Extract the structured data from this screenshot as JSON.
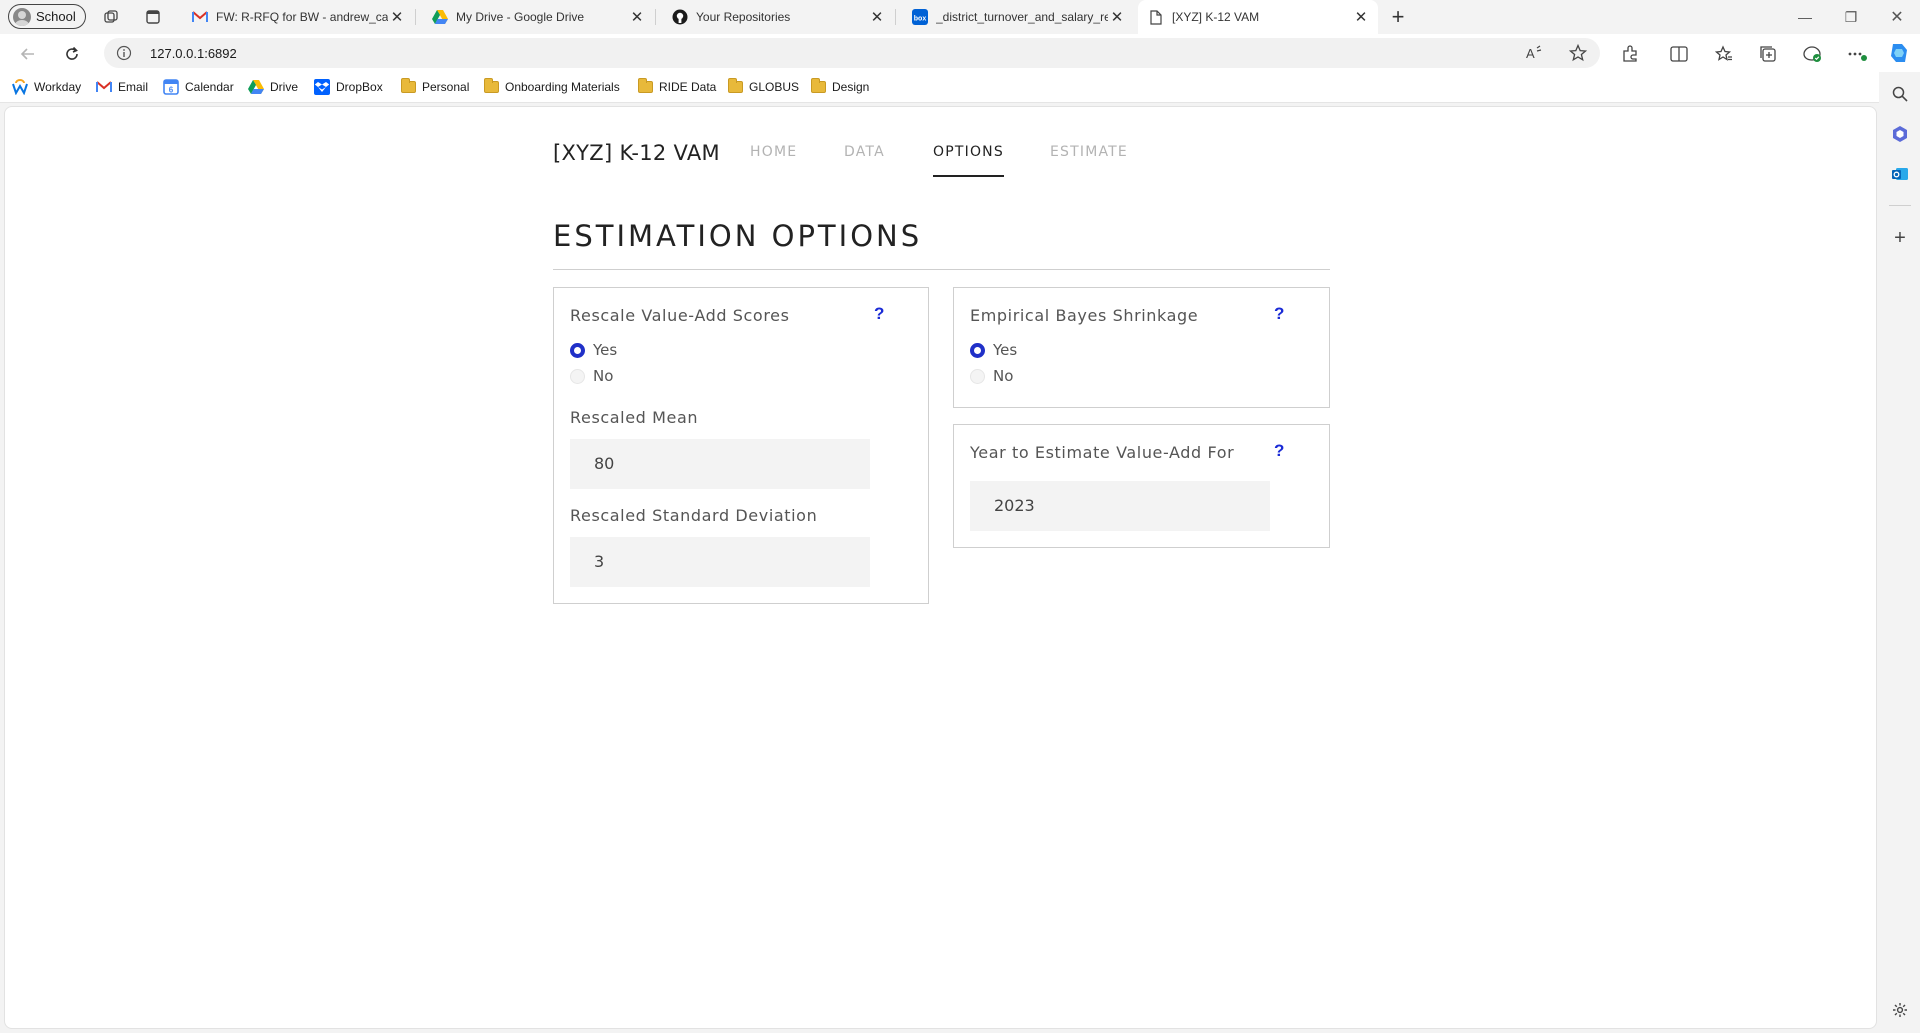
{
  "browser": {
    "profile_label": "School",
    "tabs": [
      {
        "title": "FW: R-RFQ for BW - andrew_cam"
      },
      {
        "title": "My Drive - Google Drive"
      },
      {
        "title": "Your Repositories"
      },
      {
        "title": "_district_turnover_and_salary_rep"
      },
      {
        "title": "[XYZ] K-12 VAM"
      }
    ],
    "url": "127.0.0.1:6892",
    "bookmarks": [
      {
        "label": "Workday"
      },
      {
        "label": "Email"
      },
      {
        "label": "Calendar"
      },
      {
        "label": "Drive"
      },
      {
        "label": "DropBox"
      },
      {
        "label": "Personal"
      },
      {
        "label": "Onboarding Materials"
      },
      {
        "label": "RIDE Data"
      },
      {
        "label": "GLOBUS"
      },
      {
        "label": "Design"
      }
    ],
    "colors": {
      "accent": "#2030c8",
      "help": "#1a2bd6"
    }
  },
  "app": {
    "brand": "[XYZ] K-12 VAM",
    "nav": [
      {
        "label": "HOME"
      },
      {
        "label": "DATA"
      },
      {
        "label": "OPTIONS",
        "active": true
      },
      {
        "label": "ESTIMATE"
      }
    ],
    "page_title": "ESTIMATION OPTIONS",
    "rescale": {
      "label": "Rescale Value-Add Scores",
      "help": "?",
      "options": [
        "Yes",
        "No"
      ],
      "selected": "Yes",
      "mean_label": "Rescaled Mean",
      "mean_value": "80",
      "sd_label": "Rescaled Standard Deviation",
      "sd_value": "3"
    },
    "bayes": {
      "label": "Empirical Bayes Shrinkage",
      "help": "?",
      "options": [
        "Yes",
        "No"
      ],
      "selected": "Yes"
    },
    "year": {
      "label": "Year to Estimate Value-Add For",
      "help": "?",
      "value": "2023"
    }
  }
}
